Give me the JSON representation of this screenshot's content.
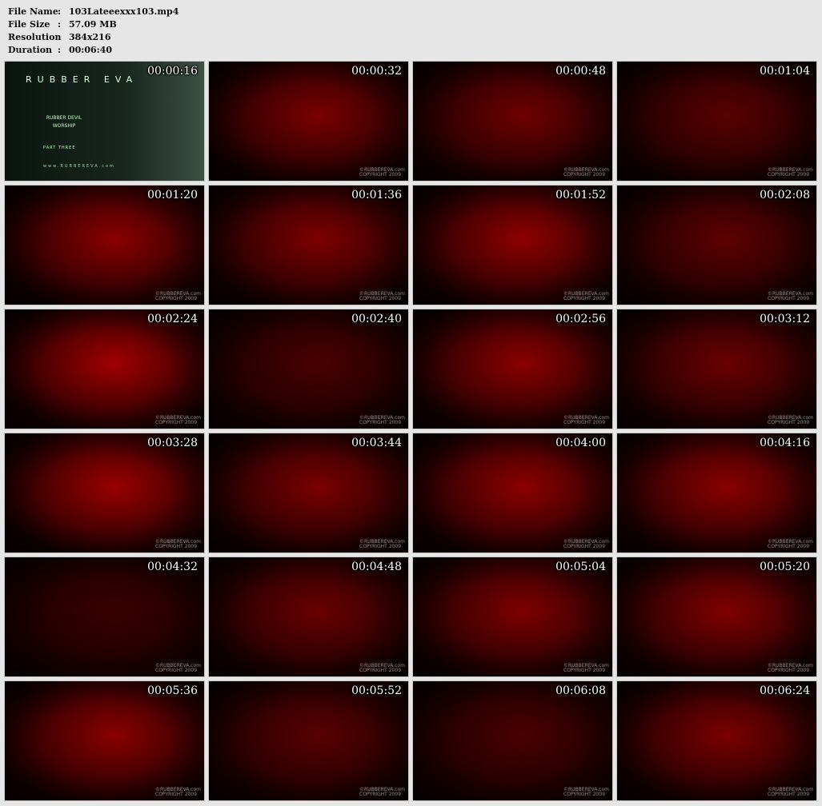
{
  "file_info": [
    {
      "key": "File Name",
      "sep": ":",
      "value": "103Lateeexxx103.mp4"
    },
    {
      "key": "File Size",
      "sep": ":",
      "value": "57.09 MB"
    },
    {
      "key": "Resolution",
      "sep": ":",
      "value": "384x216"
    },
    {
      "key": "Duration",
      "sep": ":",
      "value": "00:06:40"
    }
  ],
  "title_card": {
    "brand": "RUBBER EVA",
    "subtitle_line1": "RUBBER DEVIL",
    "subtitle_line2": "WORSHIP",
    "part": "PART THREE",
    "site": "www.RUBBEREVA.com"
  },
  "watermark": {
    "line1": "©RUBBEREVA.com",
    "line2": "COPYRIGHT 2009"
  },
  "thumbnails": [
    {
      "time": "00:00:16",
      "tone": "#0f1a14",
      "title": true
    },
    {
      "time": "00:00:32",
      "tone": "#7a0000"
    },
    {
      "time": "00:00:48",
      "tone": "#6e0000"
    },
    {
      "time": "00:01:04",
      "tone": "#5a0000"
    },
    {
      "time": "00:01:20",
      "tone": "#8a0000"
    },
    {
      "time": "00:01:36",
      "tone": "#7d0000"
    },
    {
      "time": "00:01:52",
      "tone": "#8e0000"
    },
    {
      "time": "00:02:08",
      "tone": "#5e0000"
    },
    {
      "time": "00:02:24",
      "tone": "#a00000"
    },
    {
      "time": "00:02:40",
      "tone": "#4a0000"
    },
    {
      "time": "00:02:56",
      "tone": "#8a0000"
    },
    {
      "time": "00:03:12",
      "tone": "#6a0000"
    },
    {
      "time": "00:03:28",
      "tone": "#9a0000"
    },
    {
      "time": "00:03:44",
      "tone": "#7a0000"
    },
    {
      "time": "00:04:00",
      "tone": "#8c0000"
    },
    {
      "time": "00:04:16",
      "tone": "#8a0000"
    },
    {
      "time": "00:04:32",
      "tone": "#3a0000"
    },
    {
      "time": "00:04:48",
      "tone": "#6a0000"
    },
    {
      "time": "00:05:04",
      "tone": "#7e0000"
    },
    {
      "time": "00:05:20",
      "tone": "#800000"
    },
    {
      "time": "00:05:36",
      "tone": "#8a0000"
    },
    {
      "time": "00:05:52",
      "tone": "#5a0000"
    },
    {
      "time": "00:06:08",
      "tone": "#4a0000"
    },
    {
      "time": "00:06:24",
      "tone": "#7a0000"
    }
  ]
}
